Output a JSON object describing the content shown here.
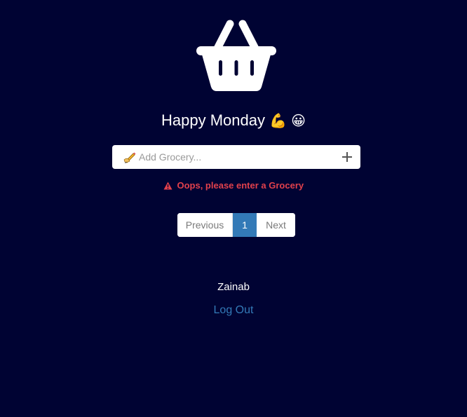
{
  "icons": {
    "logo": "shopping-basket-icon",
    "flexed_biceps": "💪",
    "grinning_face": "😀",
    "pencil": "writing-hand-icon",
    "add": "plus-icon",
    "warning": "warning-triangle-icon"
  },
  "colors": {
    "background": "#000333",
    "error": "#e2414c",
    "accent": "#337ab7",
    "text": "#ffffff"
  },
  "header": {
    "greeting": "Happy Monday",
    "emoji_1": "💪",
    "emoji_2": "😀"
  },
  "grocery_input": {
    "placeholder": "Add Grocery...",
    "value": ""
  },
  "error": {
    "message": "Oops, please enter a Grocery"
  },
  "pagination": {
    "previous_label": "Previous",
    "current_page": "1",
    "next_label": "Next"
  },
  "user": {
    "name": "Zainab",
    "logout_label": "Log Out"
  }
}
